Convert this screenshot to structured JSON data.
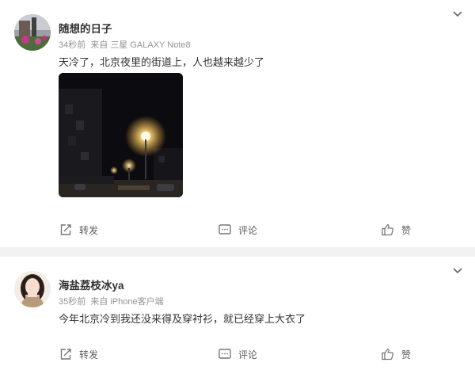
{
  "posts": [
    {
      "username": "随想的日子",
      "time": "34秒前",
      "source_prefix": "来自",
      "device": "三星 GALAXY Note8",
      "content": "天冷了，北京夜里的街道上，人也越来越少了",
      "actions": {
        "repost": "转发",
        "comment": "评论",
        "like": "赞"
      }
    },
    {
      "username": "海盐荔枝冰ya",
      "time": "35秒前",
      "source_prefix": "来自",
      "device": "iPhone客户端",
      "content": "今年北京冷到我还没来得及穿衬衫，就已经穿上大衣了",
      "actions": {
        "repost": "转发",
        "comment": "评论",
        "like": "赞"
      }
    }
  ],
  "colors": {
    "accent_text": "#333333",
    "meta_text": "#939393",
    "action_text": "#5c5c5c",
    "separator": "#f2f2f2"
  },
  "icons": [
    "chevron-down-icon",
    "repost-icon",
    "comment-icon",
    "like-icon"
  ]
}
